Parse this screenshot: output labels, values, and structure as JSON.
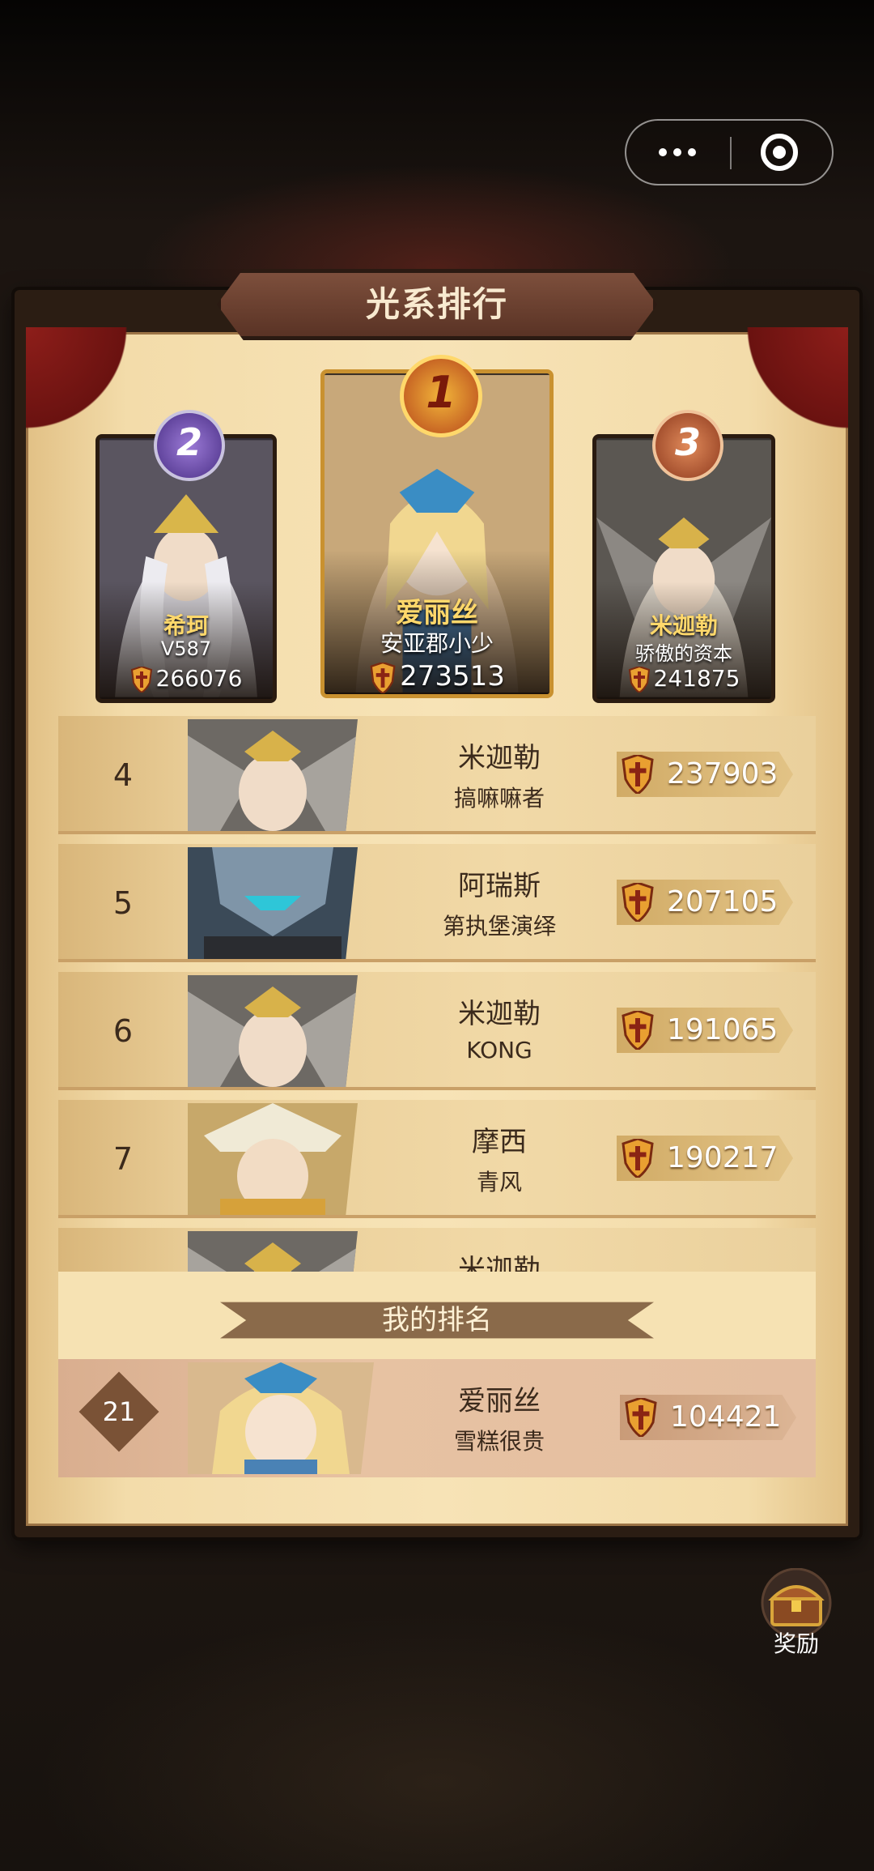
{
  "colors": {
    "gold": "#ffd86b",
    "frame": "#2b1d13",
    "parchment": "#f3dcaa",
    "curtain": "#8e1e1a"
  },
  "board": {
    "title": "光系排行"
  },
  "podium": [
    {
      "rank": "2",
      "hero": "希珂",
      "player": "V587",
      "power": "266076"
    },
    {
      "rank": "1",
      "hero": "爱丽丝",
      "player": "安亚郡小少",
      "power": "273513"
    },
    {
      "rank": "3",
      "hero": "米迦勒",
      "player": "骄傲的资本",
      "power": "241875"
    }
  ],
  "list": [
    {
      "rank": "4",
      "hero": "米迦勒",
      "player": "搞嘛嘛者",
      "power": "237903"
    },
    {
      "rank": "5",
      "hero": "阿瑞斯",
      "player": "第执堡演绎",
      "power": "207105"
    },
    {
      "rank": "6",
      "hero": "米迦勒",
      "player": "KONG",
      "power": "191065"
    },
    {
      "rank": "7",
      "hero": "摩西",
      "player": "青风",
      "power": "190217"
    },
    {
      "rank": "",
      "hero": "米迦勒",
      "player": "",
      "power": ""
    }
  ],
  "my_rank": {
    "label": "我的排名",
    "rank": "21",
    "hero": "爱丽丝",
    "player": "雪糕很贵",
    "power": "104421"
  },
  "reward": {
    "label": "奖励",
    "icon": "treasure-chest-icon"
  }
}
